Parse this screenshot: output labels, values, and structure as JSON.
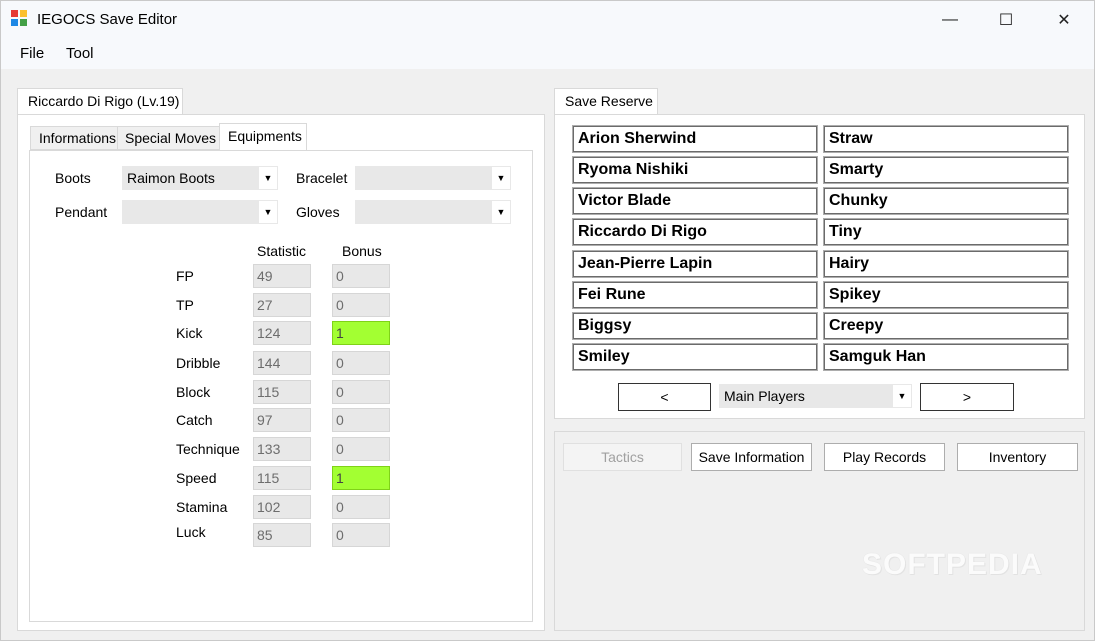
{
  "window": {
    "title": "IEGOCS Save Editor",
    "minimize": "—",
    "maximize": "☐",
    "close": "✕"
  },
  "menu": [
    "File",
    "Tool"
  ],
  "player_tab": "Riccardo Di Rigo (Lv.19)",
  "subtabs": [
    "Informations",
    "Special Moves",
    "Equipments"
  ],
  "equipment": {
    "boots_label": "Boots",
    "boots_value": "Raimon Boots",
    "bracelet_label": "Bracelet",
    "bracelet_value": "",
    "pendant_label": "Pendant",
    "pendant_value": "",
    "gloves_label": "Gloves",
    "gloves_value": ""
  },
  "stats": {
    "statistic_header": "Statistic",
    "bonus_header": "Bonus",
    "rows": [
      {
        "name": "FP",
        "stat": "49",
        "bonus": "0",
        "highlight": false
      },
      {
        "name": "TP",
        "stat": "27",
        "bonus": "0",
        "highlight": false
      },
      {
        "name": "Kick",
        "stat": "124",
        "bonus": "1",
        "highlight": true
      },
      {
        "name": "Dribble",
        "stat": "144",
        "bonus": "0",
        "highlight": false
      },
      {
        "name": "Block",
        "stat": "115",
        "bonus": "0",
        "highlight": false
      },
      {
        "name": "Catch",
        "stat": "97",
        "bonus": "0",
        "highlight": false
      },
      {
        "name": "Technique",
        "stat": "133",
        "bonus": "0",
        "highlight": false
      },
      {
        "name": "Speed",
        "stat": "115",
        "bonus": "1",
        "highlight": true
      },
      {
        "name": "Stamina",
        "stat": "102",
        "bonus": "0",
        "highlight": false
      },
      {
        "name": "Luck",
        "stat": "85",
        "bonus": "0",
        "highlight": false
      }
    ]
  },
  "reserve": {
    "tab": "Save Reserve",
    "players": [
      "Arion Sherwind",
      "Straw",
      "Ryoma Nishiki",
      "Smarty",
      "Victor Blade",
      "Chunky",
      "Riccardo Di Rigo",
      "Tiny",
      "Jean-Pierre Lapin",
      "Hairy",
      "Fei Rune",
      "Spikey",
      "Biggsy",
      "Creepy",
      "Smiley",
      "Samguk Han"
    ],
    "prev": "<",
    "next": ">",
    "group": "Main Players"
  },
  "actions": {
    "tactics": "Tactics",
    "save_information": "Save Information",
    "play_records": "Play Records",
    "inventory": "Inventory"
  },
  "watermark": "SOFTPEDIA",
  "colors": {
    "bonus_highlight": "#a3ff32",
    "window_bg": "#f0f0f0"
  }
}
